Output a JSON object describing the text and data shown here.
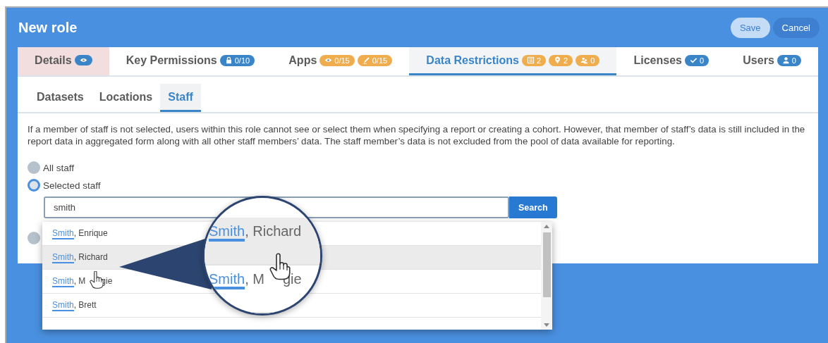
{
  "window": {
    "title": "New role"
  },
  "actions": [
    {
      "label": "Save",
      "disabled": true
    },
    {
      "label": "Cancel",
      "disabled": false
    }
  ],
  "tabs": [
    {
      "label": "Details",
      "selected": false,
      "alert": true,
      "badges": [
        {
          "kind": "eye",
          "color": "#3a85c8"
        }
      ]
    },
    {
      "label": "Key Permissions",
      "selected": false,
      "alert": false,
      "badges": [
        {
          "kind": "lock",
          "text": "0/10",
          "color": "#3a85c8"
        }
      ]
    },
    {
      "label": "Apps",
      "selected": false,
      "alert": false,
      "badges": [
        {
          "kind": "eye",
          "text": "0/15",
          "color": "#f0ad4e"
        },
        {
          "kind": "pen",
          "text": "0/15",
          "color": "#f0ad4e"
        }
      ]
    },
    {
      "label": "Data Restrictions",
      "selected": true,
      "alert": false,
      "badges": [
        {
          "kind": "list",
          "text": "2",
          "color": "#f0ad4e"
        },
        {
          "kind": "pin",
          "text": "2",
          "color": "#f0ad4e"
        },
        {
          "kind": "people",
          "text": "0",
          "color": "#f0ad4e"
        }
      ]
    },
    {
      "label": "Licenses",
      "selected": false,
      "alert": false,
      "badges": [
        {
          "kind": "check",
          "text": "0",
          "color": "#3a85c8"
        }
      ]
    },
    {
      "label": "Users",
      "selected": false,
      "alert": false,
      "badges": [
        {
          "kind": "user",
          "text": "0",
          "color": "#3a85c8"
        }
      ]
    }
  ],
  "subtabs": [
    {
      "label": "Datasets",
      "selected": false
    },
    {
      "label": "Locations",
      "selected": false
    },
    {
      "label": "Staff",
      "selected": true
    }
  ],
  "description": "If a member of staff is not selected, users within this role cannot see or select them when specifying a report or creating a cohort. However, that member of staff’s data is still included in the report data in aggregated form along with all other staff members’ data. The staff member’s data is not excluded from the pool of data available for reporting.",
  "staff_scope": [
    {
      "label": "All staff",
      "selected": false
    },
    {
      "label": "Selected staff",
      "selected": true
    },
    {
      "selected": false
    }
  ],
  "search": {
    "value": "smith",
    "button": "Search"
  },
  "results": [
    {
      "match": "Smith",
      "rest": ", Enrique",
      "hovered": false
    },
    {
      "match": "Smith",
      "rest": ", Richard",
      "hovered": true
    },
    {
      "match": "Smith",
      "rest": ", M",
      "tail": "gie",
      "hovered": false
    },
    {
      "match": "Smith",
      "rest": ", Brett",
      "hovered": false
    }
  ],
  "magnifier": {
    "rows": [
      {
        "match": "Smith",
        "rest": ", Richard",
        "hovered": true
      },
      {
        "match": "Smith",
        "rest": ", M",
        "tail": "gie",
        "hovered": false
      }
    ]
  }
}
